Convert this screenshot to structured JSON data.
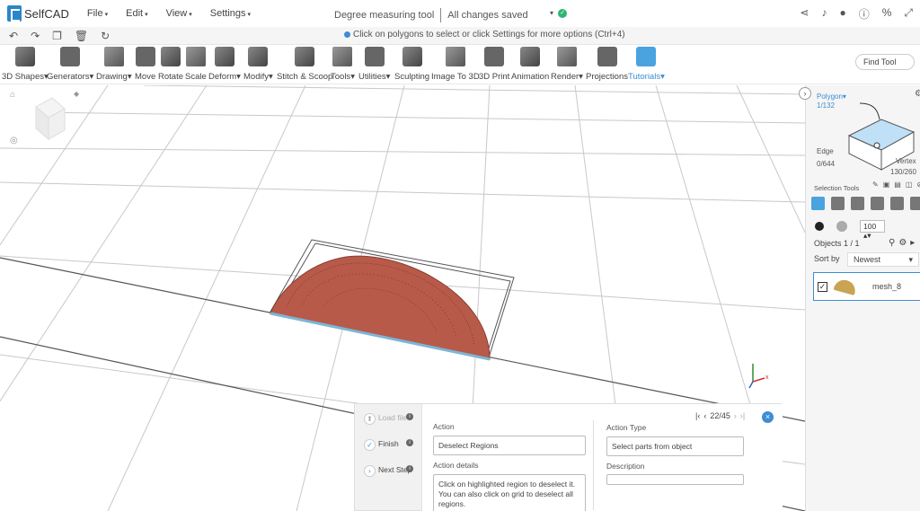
{
  "app": {
    "name": "SelfCAD"
  },
  "menu": [
    {
      "label": "File"
    },
    {
      "label": "Edit"
    },
    {
      "label": "View"
    },
    {
      "label": "Settings"
    }
  ],
  "document": {
    "title": "Degree measuring tool",
    "status": "All changes saved"
  },
  "hint": "Click on polygons to select or click Settings for more options (Ctrl+4)",
  "toolbar": [
    {
      "label": "3D Shapes",
      "caret": true
    },
    {
      "label": "Generators",
      "caret": true
    },
    {
      "label": "Drawing",
      "caret": true
    },
    {
      "label": "Move",
      "caret": false
    },
    {
      "label": "Rotate",
      "caret": false
    },
    {
      "label": "Scale",
      "caret": false
    },
    {
      "label": "Deform",
      "caret": true
    },
    {
      "label": "Modify",
      "caret": true
    },
    {
      "label": "Stitch & Scoop",
      "caret": false
    },
    {
      "label": "Tools",
      "caret": true
    },
    {
      "label": "Utilities",
      "caret": true
    },
    {
      "label": "Sculpting",
      "caret": false
    },
    {
      "label": "Image To 3D",
      "caret": false
    },
    {
      "label": "3D Print",
      "caret": false
    },
    {
      "label": "Animation",
      "caret": false
    },
    {
      "label": "Render",
      "caret": true
    },
    {
      "label": "Projections",
      "caret": false
    },
    {
      "label": "Tutorials",
      "caret": true
    }
  ],
  "find_tool": "Find Tool",
  "selection": {
    "polygon_label": "Polygon",
    "polygon_count": "1/132",
    "edge_label": "Edge",
    "edge_count": "0/644",
    "vertex_label": "Vertex",
    "vertex_count": "130/260",
    "tools_label": "Selection Tools",
    "brush_size": "100"
  },
  "objects": {
    "label": "Objects 1 / 1",
    "sort_label": "Sort by",
    "sort_value": "Newest",
    "items": [
      {
        "name": "mesh_8",
        "checked": true
      }
    ]
  },
  "tutorial": {
    "steps": [
      {
        "label": "Load file",
        "state": "disabled"
      },
      {
        "label": "Finish",
        "state": "done"
      },
      {
        "label": "Next Step",
        "state": "next"
      }
    ],
    "action_label": "Action",
    "action_value": "Deselect Regions",
    "action_details_label": "Action details",
    "action_details": "Click on highlighted region to deselect it. You can also click on grid to deselect all regions.",
    "action_type_label": "Action Type",
    "action_type_value": "Select parts from object",
    "description_label": "Description",
    "description_value": "",
    "pager": "22/45"
  },
  "colors": {
    "accent": "#3c8dd3",
    "protractor": "#b85a4a",
    "protractor_edge": "#7cb6d6",
    "grid": "#c8c8c8"
  }
}
